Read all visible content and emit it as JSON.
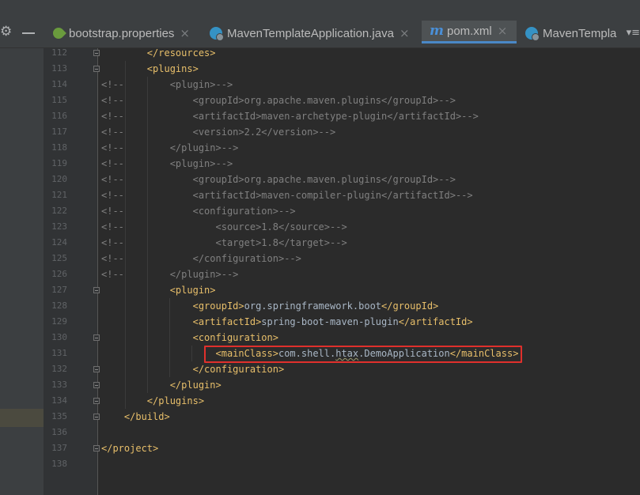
{
  "tabs": [
    {
      "label": "bootstrap.properties",
      "icon": "spring-boot-icon",
      "active": false
    },
    {
      "label": "MavenTemplateApplication.java",
      "icon": "java-class-icon",
      "active": false
    },
    {
      "label": "pom.xml",
      "icon": "maven-icon",
      "active": true
    },
    {
      "label": "MavenTempla",
      "icon": "java-class-icon",
      "active": false
    }
  ],
  "tab_close_glyph": "×",
  "maven_icon_glyph": "m",
  "colors": {
    "tag": "#e8bf6a",
    "comment": "#808080",
    "text": "#a9b7c6",
    "highlight_box": "#e0302c",
    "active_tab_underline": "#4a88c7"
  },
  "editor": {
    "lines": [
      {
        "num": "112",
        "comment": "",
        "indent": "        ",
        "segments": [
          {
            "t": "tag",
            "v": "</resources>"
          }
        ]
      },
      {
        "num": "113",
        "comment": "",
        "indent": "        ",
        "segments": [
          {
            "t": "tag",
            "v": "<plugins>"
          }
        ]
      },
      {
        "num": "114",
        "comment": "<!--",
        "indent": "            ",
        "segments": [
          {
            "t": "cmt",
            "v": "<plugin>-->"
          }
        ]
      },
      {
        "num": "115",
        "comment": "<!--",
        "indent": "                ",
        "segments": [
          {
            "t": "cmt",
            "v": "<groupId>org.apache.maven.plugins</groupId>-->"
          }
        ]
      },
      {
        "num": "116",
        "comment": "<!--",
        "indent": "                ",
        "segments": [
          {
            "t": "cmt",
            "v": "<artifactId>maven-archetype-plugin</artifactId>-->"
          }
        ]
      },
      {
        "num": "117",
        "comment": "<!--",
        "indent": "                ",
        "segments": [
          {
            "t": "cmt",
            "v": "<version>2.2</version>-->"
          }
        ]
      },
      {
        "num": "118",
        "comment": "<!--",
        "indent": "            ",
        "segments": [
          {
            "t": "cmt",
            "v": "</plugin>-->"
          }
        ]
      },
      {
        "num": "119",
        "comment": "<!--",
        "indent": "            ",
        "segments": [
          {
            "t": "cmt",
            "v": "<plugin>-->"
          }
        ]
      },
      {
        "num": "120",
        "comment": "<!--",
        "indent": "                ",
        "segments": [
          {
            "t": "cmt",
            "v": "<groupId>org.apache.maven.plugins</groupId>-->"
          }
        ]
      },
      {
        "num": "121",
        "comment": "<!--",
        "indent": "                ",
        "segments": [
          {
            "t": "cmt",
            "v": "<artifactId>maven-compiler-plugin</artifactId>-->"
          }
        ]
      },
      {
        "num": "122",
        "comment": "<!--",
        "indent": "                ",
        "segments": [
          {
            "t": "cmt",
            "v": "<configuration>-->"
          }
        ]
      },
      {
        "num": "123",
        "comment": "<!--",
        "indent": "                    ",
        "segments": [
          {
            "t": "cmt",
            "v": "<source>1.8</source>-->"
          }
        ]
      },
      {
        "num": "124",
        "comment": "<!--",
        "indent": "                    ",
        "segments": [
          {
            "t": "cmt",
            "v": "<target>1.8</target>-->"
          }
        ]
      },
      {
        "num": "125",
        "comment": "<!--",
        "indent": "                ",
        "segments": [
          {
            "t": "cmt",
            "v": "</configuration>-->"
          }
        ]
      },
      {
        "num": "126",
        "comment": "<!--",
        "indent": "            ",
        "segments": [
          {
            "t": "cmt",
            "v": "</plugin>-->"
          }
        ]
      },
      {
        "num": "127",
        "comment": "",
        "indent": "            ",
        "segments": [
          {
            "t": "tag",
            "v": "<plugin>"
          }
        ]
      },
      {
        "num": "128",
        "comment": "",
        "indent": "                ",
        "segments": [
          {
            "t": "tag",
            "v": "<groupId>"
          },
          {
            "t": "txt",
            "v": "org.springframework.boot"
          },
          {
            "t": "tag",
            "v": "</groupId>"
          }
        ]
      },
      {
        "num": "129",
        "comment": "",
        "indent": "                ",
        "segments": [
          {
            "t": "tag",
            "v": "<artifactId>"
          },
          {
            "t": "txt",
            "v": "spring-boot-maven-plugin"
          },
          {
            "t": "tag",
            "v": "</artifactId>"
          }
        ]
      },
      {
        "num": "130",
        "comment": "",
        "indent": "                ",
        "segments": [
          {
            "t": "tag",
            "v": "<configuration>"
          }
        ]
      },
      {
        "num": "131",
        "comment": "",
        "indent": "                    ",
        "segments": [
          {
            "t": "tag",
            "v": "<mainClass>"
          },
          {
            "t": "txt",
            "v": "com.shell."
          },
          {
            "t": "txt-sq",
            "v": "htax"
          },
          {
            "t": "txt",
            "v": ".DemoApplication"
          },
          {
            "t": "tag",
            "v": "</mainClass>"
          }
        ]
      },
      {
        "num": "132",
        "comment": "",
        "indent": "                ",
        "segments": [
          {
            "t": "tag",
            "v": "</configuration>"
          }
        ]
      },
      {
        "num": "133",
        "comment": "",
        "indent": "            ",
        "segments": [
          {
            "t": "tag",
            "v": "</plugin>"
          }
        ]
      },
      {
        "num": "134",
        "comment": "",
        "indent": "        ",
        "segments": [
          {
            "t": "tag",
            "v": "</plugins>"
          }
        ]
      },
      {
        "num": "135",
        "comment": "",
        "indent": "    ",
        "segments": [
          {
            "t": "tag",
            "v": "</build>"
          }
        ]
      },
      {
        "num": "136",
        "comment": "",
        "indent": "",
        "segments": []
      },
      {
        "num": "137",
        "comment": "",
        "indent": "",
        "segments": [
          {
            "t": "tag",
            "v": "</project>"
          }
        ]
      },
      {
        "num": "138",
        "comment": "",
        "indent": "",
        "segments": []
      }
    ]
  }
}
